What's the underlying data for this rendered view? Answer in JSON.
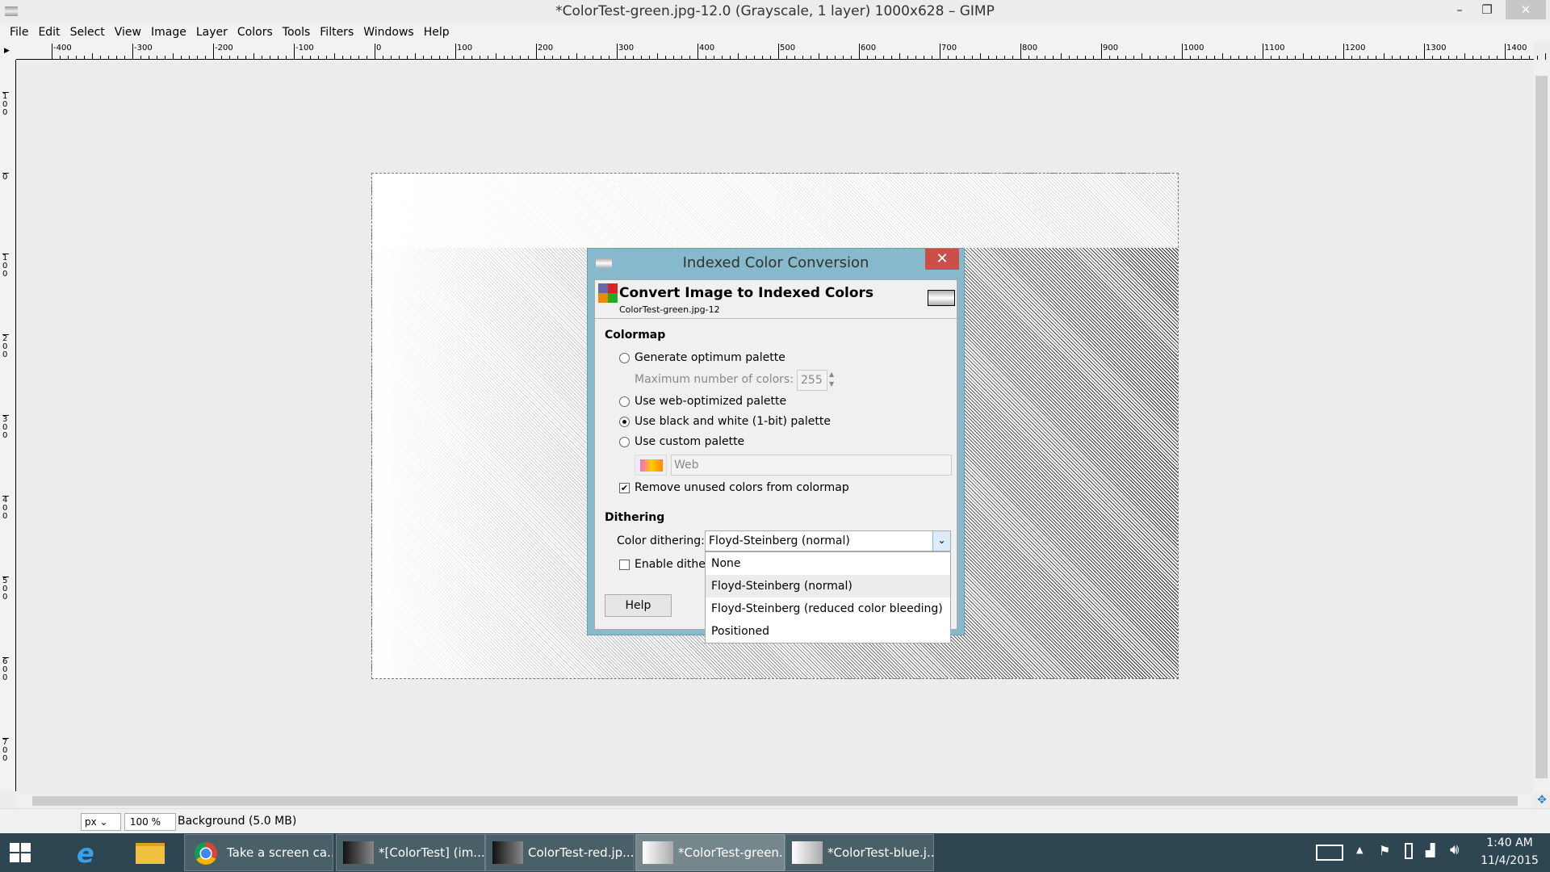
{
  "window": {
    "title": "*ColorTest-green.jpg-12.0 (Grayscale, 1 layer) 1000x628 – GIMP",
    "minimize": "–",
    "maximize": "❐",
    "close": "✕"
  },
  "menu": [
    "File",
    "Edit",
    "Select",
    "View",
    "Image",
    "Layer",
    "Colors",
    "Tools",
    "Filters",
    "Windows",
    "Help"
  ],
  "ruler": {
    "h_labels": [
      "-400",
      "-300",
      "-200",
      "-100",
      "0",
      "100",
      "200",
      "300",
      "400",
      "500",
      "600",
      "700",
      "800",
      "900",
      "1000",
      "1100",
      "1200",
      "1300",
      "1400"
    ],
    "v_labels": [
      "100",
      "0",
      "100",
      "200",
      "300",
      "400",
      "500",
      "600",
      "700"
    ]
  },
  "status": {
    "unit": "px",
    "zoom": "100 %",
    "layer": "Background (5.0 MB)"
  },
  "dialog": {
    "title": "Indexed Color Conversion",
    "close": "✕",
    "heading": "Convert Image to Indexed Colors",
    "subheading": "ColorTest-green.jpg-12",
    "colormap_label": "Colormap",
    "radios": [
      {
        "label": "Generate optimum palette",
        "checked": false
      },
      {
        "label": "Use web-optimized palette",
        "checked": false
      },
      {
        "label": "Use black and white (1-bit) palette",
        "checked": true
      },
      {
        "label": "Use custom palette",
        "checked": false
      }
    ],
    "max_colors_label": "Maximum number of colors:",
    "max_colors_value": "255",
    "custom_palette_value": "Web",
    "remove_unused_label": "Remove unused colors from colormap",
    "remove_unused_checked": true,
    "dithering_label": "Dithering",
    "color_dithering_label": "Color dithering:",
    "color_dithering_value": "Floyd-Steinberg (normal)",
    "enable_dither_label": "Enable dither",
    "enable_dither_checked": false,
    "help_button": "Help",
    "dropdown_options": [
      "None",
      "Floyd-Steinberg (normal)",
      "Floyd-Steinberg (reduced color bleeding)",
      "Positioned"
    ],
    "dropdown_highlighted": "Floyd-Steinberg (normal)"
  },
  "taskbar": {
    "tasks": [
      "Take a screen ca...",
      "*[ColorTest] (im...",
      "ColorTest-red.jp...",
      "*ColorTest-green...",
      "*ColorTest-blue.j..."
    ],
    "active_task": "*ColorTest-green...",
    "time": "1:40 AM",
    "date": "11/4/2015"
  }
}
